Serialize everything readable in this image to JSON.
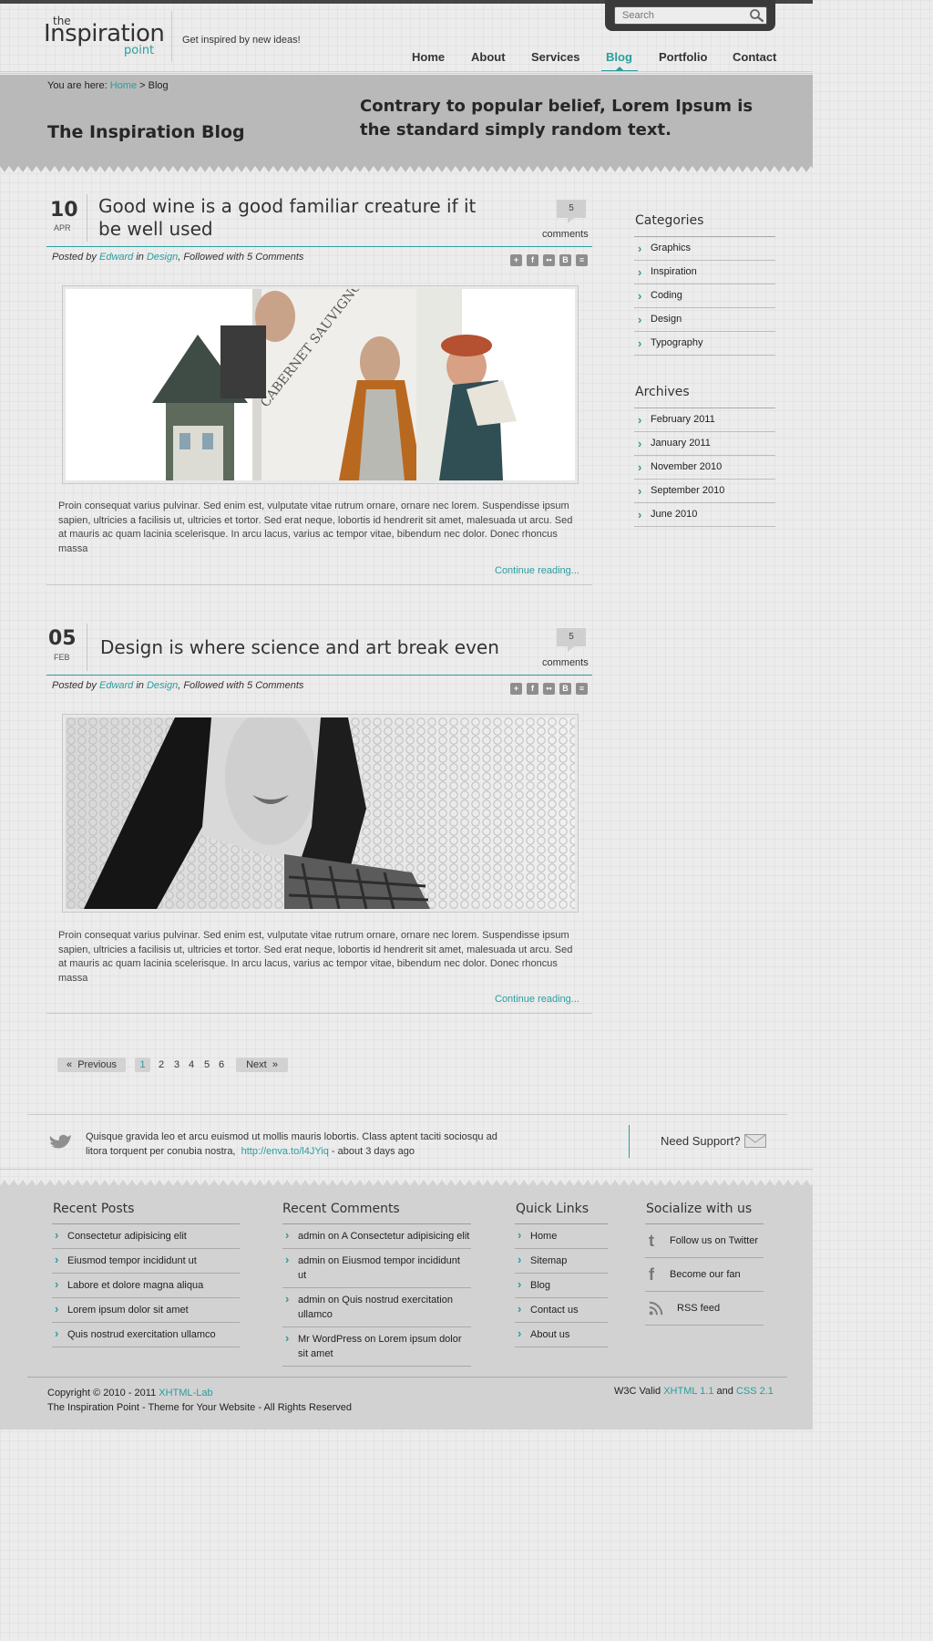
{
  "header": {
    "logo": {
      "the": "the",
      "main": "Inspiration",
      "point": "point"
    },
    "tagline": "Get inspired by new ideas!",
    "search_placeholder": "Search",
    "nav": [
      {
        "label": "Home",
        "active": false
      },
      {
        "label": "About",
        "active": false
      },
      {
        "label": "Services",
        "active": false
      },
      {
        "label": "Blog",
        "active": true
      },
      {
        "label": "Portfolio",
        "active": false
      },
      {
        "label": "Contact",
        "active": false
      }
    ]
  },
  "banner": {
    "breadcrumb": {
      "prefix": "You are here:",
      "home": "Home",
      "separator": ">",
      "current": "Blog"
    },
    "title": "The Inspiration Blog",
    "quote": "Contrary to popular belief, Lorem Ipsum is the standard simply random text."
  },
  "posts": [
    {
      "day": "10",
      "month": "APR",
      "title": "Good wine is a good familiar creature if it be well used",
      "comment_count": "5",
      "comments_label": "comments",
      "meta": {
        "posted_by": "Posted by",
        "author": "Edward",
        "in": "in",
        "category": "Design",
        "followed": ", Followed with 5 Comments"
      },
      "excerpt": "Proin consequat varius pulvinar. Sed enim est, vulputate vitae rutrum ornare, ornare nec lorem. Suspendisse ipsum sapien, ultricies a facilisis ut, ultricies et tortor. Sed erat neque, lobortis id hendrerit sit amet, malesuada ut arcu. Sed at mauris ac quam lacinia scelerisque. In arcu lacus, varius ac tempor vitae, bibendum nec dolor. Donec rhoncus massa",
      "continue": "Continue reading..."
    },
    {
      "day": "05",
      "month": "FEB",
      "title": "Design is where science and art break even",
      "comment_count": "5",
      "comments_label": "comments",
      "meta": {
        "posted_by": "Posted by",
        "author": "Edward",
        "in": "in",
        "category": "Design",
        "followed": ", Followed with 5 Comments"
      },
      "excerpt": "Proin consequat varius pulvinar. Sed enim est, vulputate vitae rutrum ornare, ornare nec lorem. Suspendisse ipsum sapien, ultricies a facilisis ut, ultricies et tortor. Sed erat neque, lobortis id hendrerit sit amet, malesuada ut arcu. Sed at mauris ac quam lacinia scelerisque. In arcu lacus, varius ac tempor vitae, bibendum nec dolor. Donec rhoncus massa",
      "continue": "Continue reading..."
    }
  ],
  "sidebar": {
    "categories_title": "Categories",
    "categories": [
      "Graphics",
      "Inspiration",
      "Coding",
      "Design",
      "Typography"
    ],
    "archives_title": "Archives",
    "archives": [
      "February 2011",
      "January 2011",
      "November 2010",
      "September 2010",
      "June 2010"
    ]
  },
  "pagination": {
    "previous": "Previous",
    "next": "Next",
    "pages": [
      "1",
      "2",
      "3",
      "4",
      "5",
      "6"
    ],
    "current": "1"
  },
  "twitter": {
    "text": "Quisque gravida leo et arcu euismod ut mollis mauris lobortis. Class aptent taciti sociosqu ad litora torquent per conubia nostra,",
    "link": "http://enva.to/l4JYiq",
    "time": "- about 3 days ago",
    "support": "Need Support?"
  },
  "footer": {
    "recent_posts_title": "Recent Posts",
    "recent_posts": [
      "Consectetur adipisicing  elit",
      "Eiusmod tempor incididunt ut",
      "Labore et dolore magna aliqua",
      "Lorem ipsum dolor sit amet",
      "Quis nostrud exercitation ullamco"
    ],
    "recent_comments_title": "Recent Comments",
    "recent_comments": [
      "admin on A Consectetur adipisicing  elit",
      "admin on Eiusmod tempor incididunt ut",
      "admin on Quis nostrud exercitation ullamco",
      "Mr WordPress on Lorem ipsum dolor sit amet"
    ],
    "quick_links_title": "Quick Links",
    "quick_links": [
      "Home",
      "Sitemap",
      "Blog",
      "Contact us",
      "About us"
    ],
    "socialize_title": "Socialize with us",
    "socialize": [
      "Follow us on Twitter",
      "Become our fan",
      "RSS feed"
    ],
    "copyright_prefix": "Copyright © 2010 - 2011",
    "copyright_link": "XHTML-Lab",
    "copyright_line2": "The Inspiration Point - Theme for Your Website - All Rights Reserved",
    "w3c_prefix": "W3C Valid",
    "xhtml": "XHTML 1.1",
    "and": "and",
    "css": "CSS 2.1"
  },
  "colors": {
    "accent": "#2a9d9d",
    "banner": "#b9b9b9",
    "footer": "#d2d2d2",
    "search_bar": "#3a3a3a"
  }
}
